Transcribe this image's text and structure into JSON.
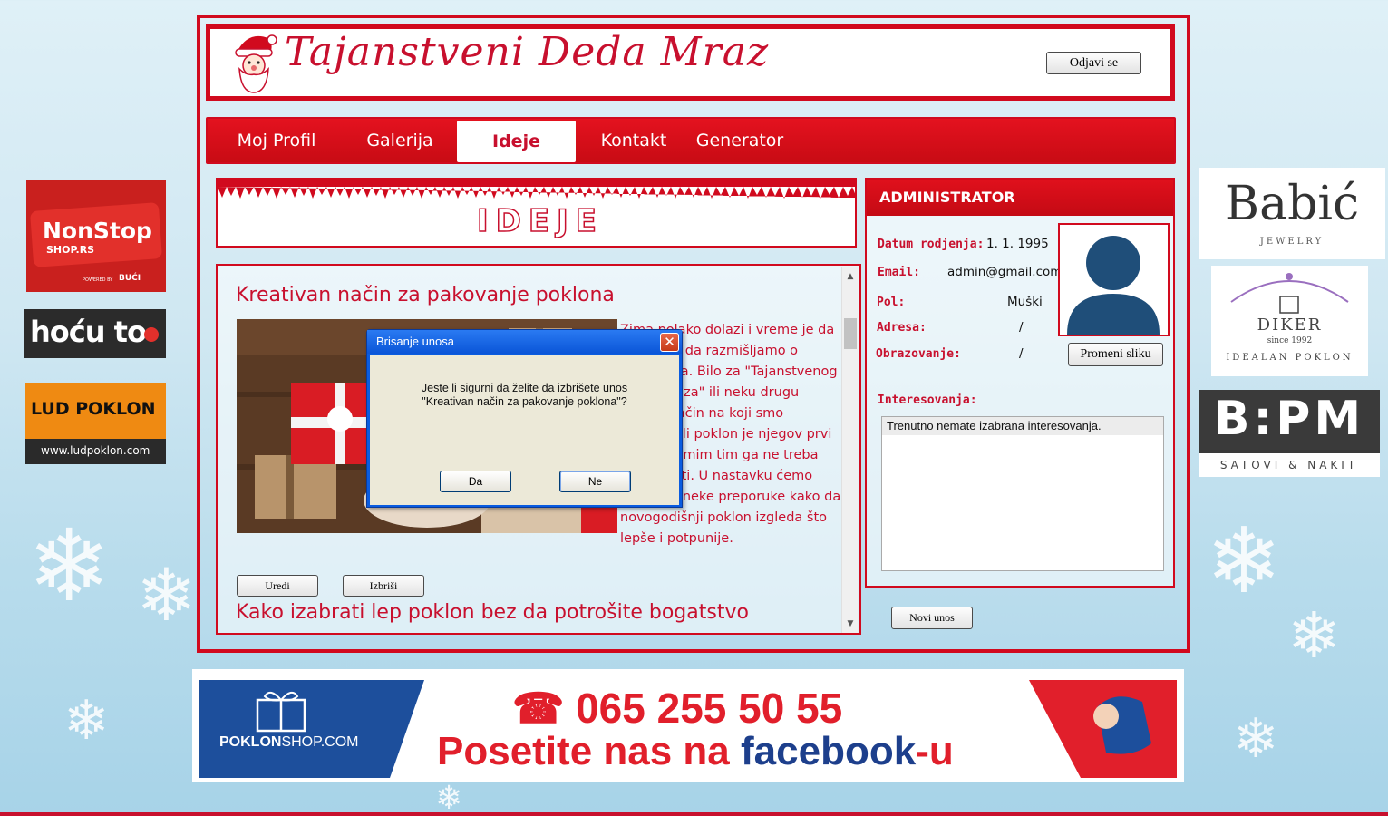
{
  "site": {
    "title": "Tajanstveni Deda Mraz",
    "logout_label": "Odjavi se"
  },
  "nav": {
    "items": [
      {
        "label": "Moj Profil"
      },
      {
        "label": "Galerija"
      },
      {
        "label": "Ideje",
        "active": true
      },
      {
        "label": "Kontakt"
      },
      {
        "label": "Generator"
      }
    ]
  },
  "ideas_banner": {
    "title": "IDEJE"
  },
  "posts": [
    {
      "title": "Kreativan način za pakovanje poklona",
      "text": "Zima polako dolazi i vreme je da počnemo da razmišljamo o poklonima. Bilo za \"Tajanstvenog Deda Mraza\" ili neku drugu priliku, način na koji smo zapakovali poklon je njegov prvi utisak, samim tim ga ne treba zanemariti. U nastavku ćemo Vam dati neke preporuke kako da novogodišnji poklon izgleda što lepše i potpunije.",
      "edit_label": "Uredi",
      "delete_label": "Izbriši"
    },
    {
      "title": "Kako izabrati lep poklon bez da potrošite bogatstvo"
    }
  ],
  "profile": {
    "header": "ADMINISTRATOR",
    "fields": [
      {
        "label": "Datum rodjenja:",
        "value": "1. 1. 1995"
      },
      {
        "label": "Email:",
        "value": "admin@gmail.com"
      },
      {
        "label": "Pol:",
        "value": "Muški"
      },
      {
        "label": "Adresa:",
        "value": "/"
      },
      {
        "label": "Obrazovanje:",
        "value": "/"
      }
    ],
    "change_photo_label": "Promeni sliku",
    "interests_label": "Interesovanja:",
    "interests_text": "Trenutno nemate izabrana interesovanja.",
    "new_entry_label": "Novi unos"
  },
  "dialog": {
    "title": "Brisanje unosa",
    "message_line1": "Jeste li sigurni da želite da izbrišete unos",
    "message_line2": "\"Kreativan način za pakovanje poklona\"?",
    "yes_label": "Da",
    "no_label": "Ne",
    "close_glyph": "✕"
  },
  "ads": {
    "nonstop": {
      "line1": "NonStop",
      "line2": "SHOP.RS",
      "tag": "POWERED BY",
      "brand": "BUĆI"
    },
    "hocu": {
      "text": "hoću to"
    },
    "lud": {
      "text": "LUD POKLON",
      "url": "www.ludpoklon.com"
    },
    "babic": {
      "name": "Babić",
      "sub": "JEWELRY"
    },
    "diker": {
      "name": "DIKER",
      "since": "since 1992",
      "sub": "IDEALAN POKLON"
    },
    "bpm": {
      "name": "B:PM",
      "sub": "SATOVI & NAKIT"
    }
  },
  "bottom_banner": {
    "brand_a": "POKLON",
    "brand_b": "SHOP.COM",
    "phone": "☎ 065 255 50 55",
    "visit_a": "Posetite nas na ",
    "visit_b": "facebook",
    "visit_c": "-u"
  },
  "colors": {
    "brand_red": "#c8102e",
    "frame_red": "#d10a1e",
    "dialog_blue": "#0a5ce0",
    "avatar_blue": "#1f4e79"
  }
}
